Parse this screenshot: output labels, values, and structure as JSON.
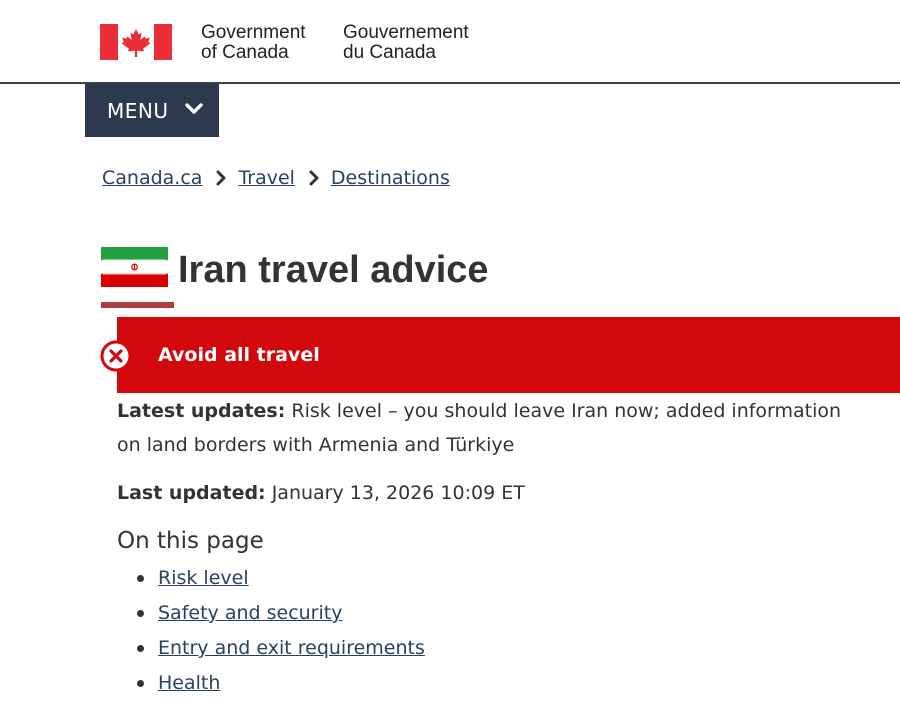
{
  "header": {
    "signature_en": [
      "Government",
      "of Canada"
    ],
    "signature_fr": [
      "Gouvernement",
      "du Canada"
    ]
  },
  "menu": {
    "label": "MENU",
    "icon": "chevron-down-icon"
  },
  "breadcrumb": {
    "items": [
      "Canada.ca",
      "Travel",
      "Destinations"
    ]
  },
  "page": {
    "title": "Iran travel advice",
    "flag_icon": "iran-flag-icon"
  },
  "alert": {
    "icon": "x-circle-icon",
    "text": "Avoid all travel",
    "color": "#d3080c"
  },
  "updates": {
    "latest_label": "Latest updates:",
    "latest_text": "Risk level – you should leave Iran now; added information on land borders with Armenia and Türkiye",
    "last_label": "Last updated:",
    "last_text": "January 13, 2026 10:09 ET"
  },
  "on_this_page": {
    "heading": "On this page",
    "links": [
      "Risk level",
      "Safety and security",
      "Entry and exit requirements",
      "Health"
    ]
  },
  "colors": {
    "link": "#284162",
    "menu_bg": "#2b3a4f",
    "canada_red": "#d3080c",
    "accent_underline": "#af3c43"
  }
}
